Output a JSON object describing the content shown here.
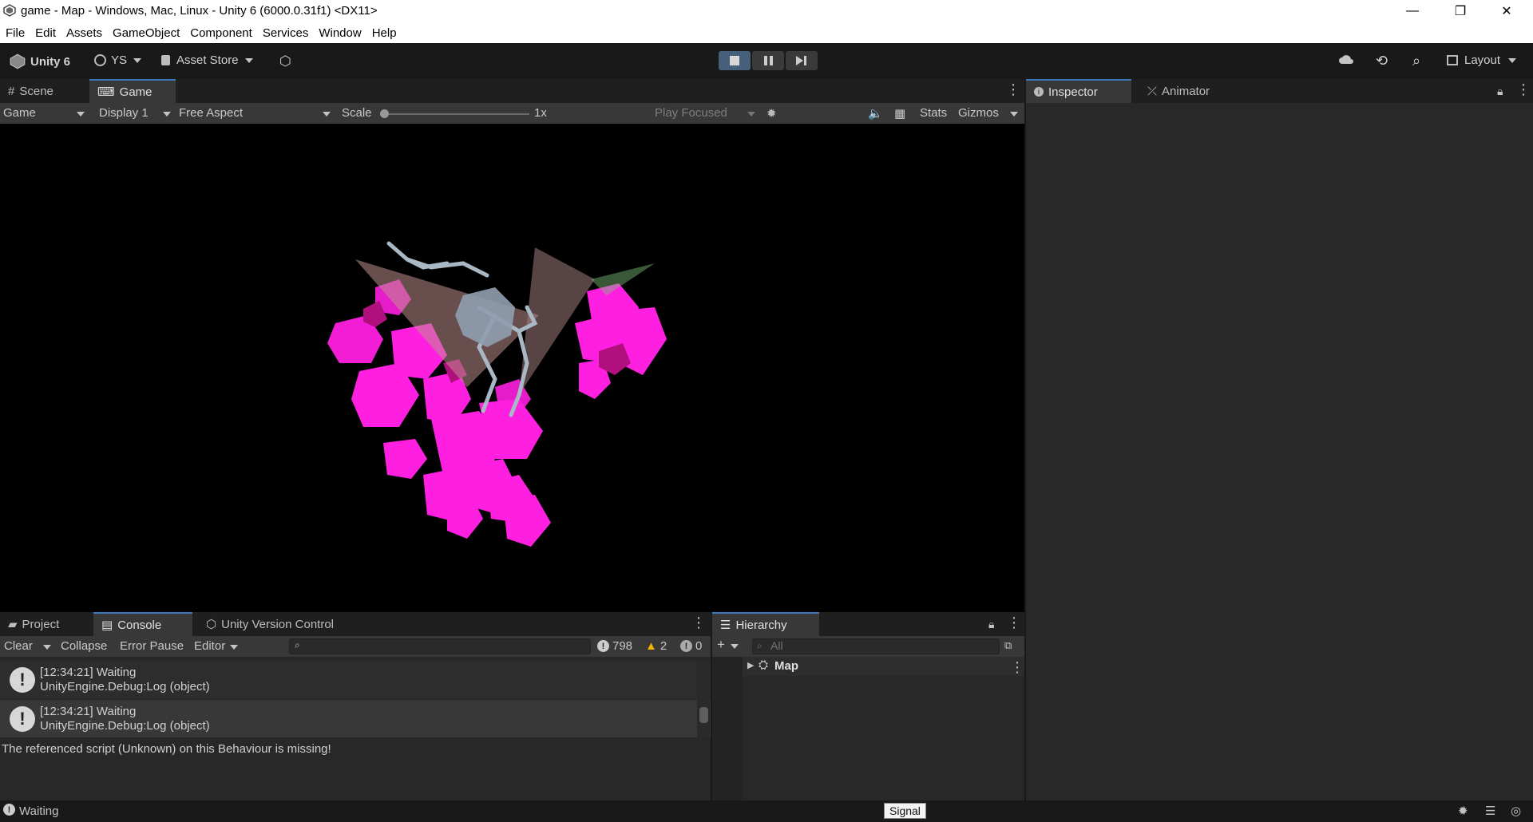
{
  "window": {
    "title": "game - Map - Windows, Mac, Linux - Unity 6 (6000.0.31f1) <DX11>",
    "minimize": "—",
    "restore": "❐",
    "close": "✕"
  },
  "menu": [
    "File",
    "Edit",
    "Assets",
    "GameObject",
    "Component",
    "Services",
    "Window",
    "Help"
  ],
  "toolbar": {
    "unity_label": "Unity 6",
    "account_label": "YS",
    "asset_store_label": "Asset Store",
    "layout_label": "Layout"
  },
  "game_panel": {
    "tabs": [
      "Scene",
      "Game"
    ],
    "active_tab": "Game",
    "controls": {
      "view": "Game",
      "display": "Display 1",
      "aspect": "Free Aspect",
      "scale_label": "Scale",
      "scale_value": "1x",
      "play_mode": "Play Focused",
      "stats": "Stats",
      "gizmos": "Gizmos"
    }
  },
  "inspector_panel": {
    "tabs": [
      "Inspector",
      "Animator"
    ],
    "active_tab": "Inspector"
  },
  "bottom_panel": {
    "tabs": [
      "Project",
      "Console",
      "Unity Version Control"
    ],
    "active_tab": "Console",
    "controls": {
      "clear": "Clear",
      "collapse": "Collapse",
      "error_pause": "Error Pause",
      "editor": "Editor"
    },
    "counts": {
      "logs": "798",
      "warnings": "2",
      "errors": "0"
    },
    "entries": [
      {
        "line1": "[12:34:21] Waiting",
        "line2": "UnityEngine.Debug:Log (object)"
      },
      {
        "line1": "[12:34:21] Waiting",
        "line2": "UnityEngine.Debug:Log (object)"
      }
    ],
    "detail": "The referenced script (Unknown) on this Behaviour is missing!"
  },
  "hierarchy_panel": {
    "tab": "Hierarchy",
    "search_placeholder": "All",
    "items": [
      "Map"
    ]
  },
  "status": {
    "message": "Waiting",
    "tooltip": "Signal"
  },
  "colors": {
    "accent": "#3a79bb",
    "crystal": "#ff1fe0",
    "background": "#191919"
  }
}
